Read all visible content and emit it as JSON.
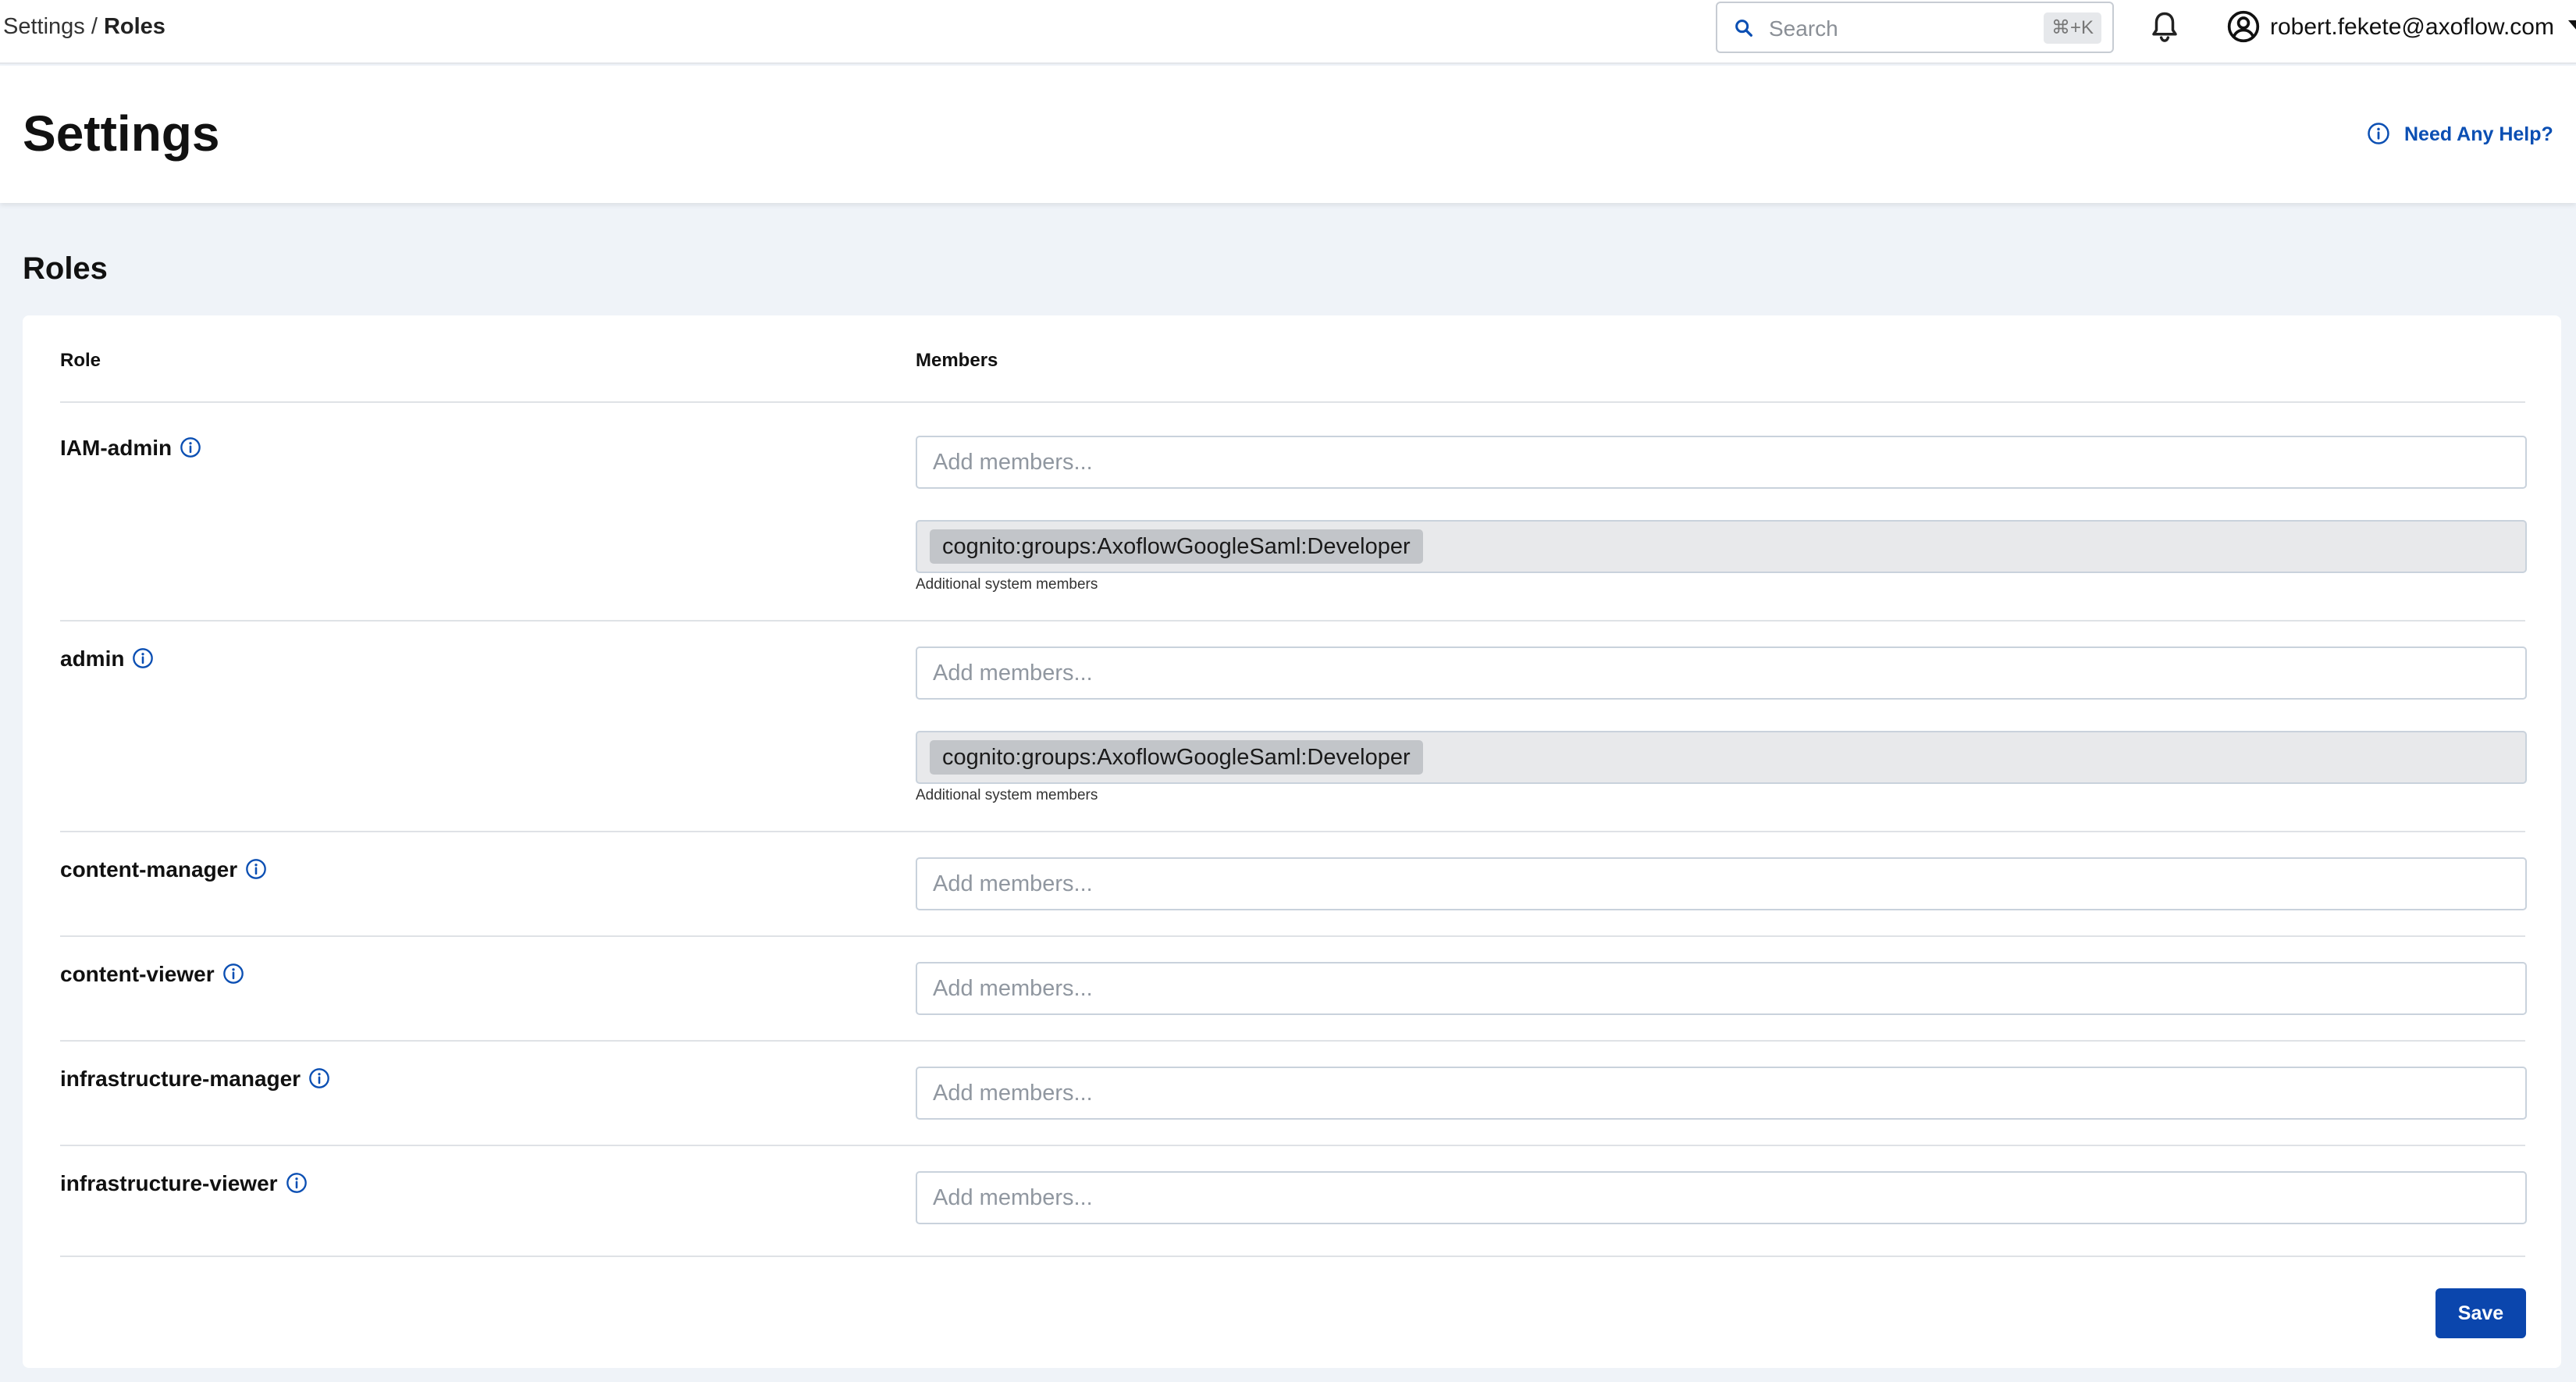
{
  "breadcrumb": {
    "parent": "Settings",
    "separator": " / ",
    "current": "Roles"
  },
  "search": {
    "placeholder": "Search",
    "shortcut": "⌘+K"
  },
  "account": {
    "email": "robert.fekete@axoflow.com"
  },
  "header": {
    "title": "Settings",
    "help_label": "Need Any Help?"
  },
  "roles_section": {
    "title": "Roles",
    "col_role": "Role",
    "col_members": "Members",
    "member_placeholder": "Add members...",
    "system_helper": "Additional system members",
    "roles": [
      {
        "name": "IAM-admin",
        "system_member": "cognito:groups:AxoflowGoogleSaml:Developer"
      },
      {
        "name": "admin",
        "system_member": "cognito:groups:AxoflowGoogleSaml:Developer"
      },
      {
        "name": "content-manager"
      },
      {
        "name": "content-viewer"
      },
      {
        "name": "infrastructure-manager"
      },
      {
        "name": "infrastructure-viewer"
      }
    ],
    "save_label": "Save"
  },
  "colors": {
    "accent": "#0b46ad",
    "link": "#0b4fb3",
    "page_bg": "#eff3f8",
    "chip_bg": "#c2c5c9"
  },
  "icons": [
    "search-icon",
    "bell-icon",
    "account-icon",
    "chevron-down-icon",
    "info-icon"
  ]
}
